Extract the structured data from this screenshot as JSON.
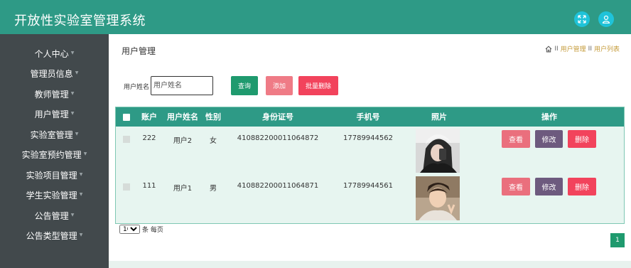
{
  "app": {
    "title": "开放性实验室管理系统"
  },
  "header_icons": {
    "fullscreen": "expand-icon",
    "user": "user-icon",
    "accent": "#1fc3d9"
  },
  "sidebar": {
    "items": [
      {
        "label": "个人中心"
      },
      {
        "label": "管理员信息"
      },
      {
        "label": "教师管理"
      },
      {
        "label": "用户管理"
      },
      {
        "label": "实验室管理"
      },
      {
        "label": "实验室预约管理"
      },
      {
        "label": "实验项目管理"
      },
      {
        "label": "学生实验管理"
      },
      {
        "label": "公告管理"
      },
      {
        "label": "公告类型管理"
      }
    ]
  },
  "page": {
    "title": "用户管理",
    "breadcrumb": {
      "sep": "II",
      "items": [
        "用户管理",
        "用户列表"
      ]
    }
  },
  "search": {
    "label": "用户姓名",
    "placeholder": "用户姓名",
    "value": ""
  },
  "toolbar": {
    "query": "查询",
    "add": "添加",
    "batch_delete": "批量删除"
  },
  "table": {
    "headers": {
      "account": "账户",
      "username": "用户姓名",
      "gender": "性别",
      "idcard": "身份证号",
      "phone": "手机号",
      "photo": "照片",
      "actions": "操作"
    },
    "rows": [
      {
        "account": "222",
        "username": "用户2",
        "gender": "女",
        "idcard": "410882200011064872",
        "phone": "17789944562"
      },
      {
        "account": "111",
        "username": "用户1",
        "gender": "男",
        "idcard": "410882200011064871",
        "phone": "17789944561"
      }
    ],
    "actions": {
      "view": "查看",
      "edit": "修改",
      "delete": "删除"
    }
  },
  "pagination": {
    "page_size": "10",
    "page_size_suffix": "条 每页",
    "current_page": "1"
  },
  "colors": {
    "primary": "#2e9a86",
    "sidebar": "#42494c",
    "query_btn": "#1f9a6e",
    "add_btn": "#ef7b86",
    "delete_btn": "#f2435c",
    "edit_btn": "#6d5a7e"
  }
}
